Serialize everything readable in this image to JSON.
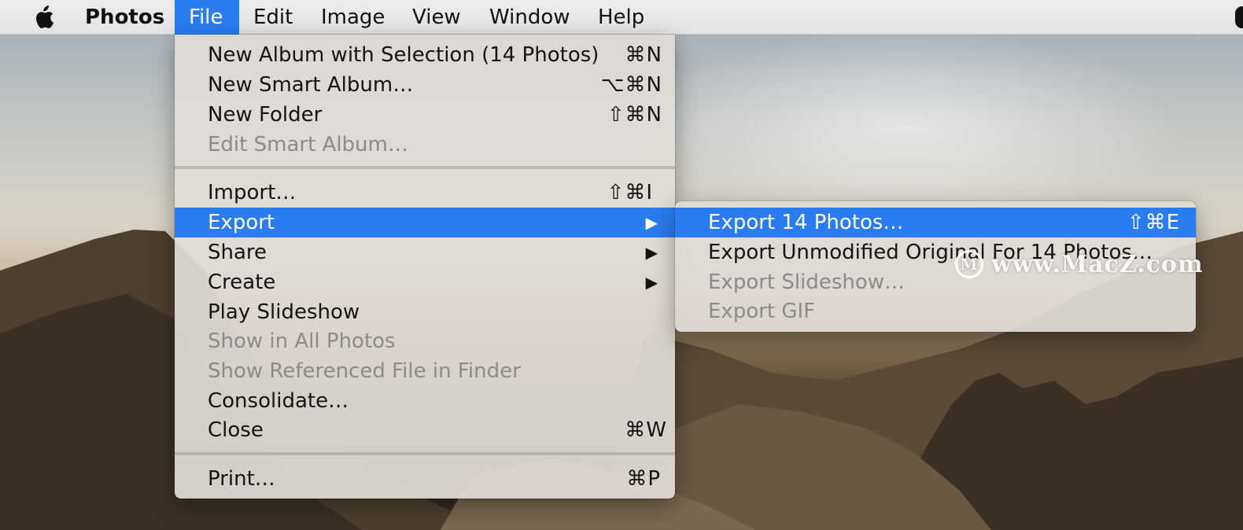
{
  "menubar": {
    "app_name": "Photos",
    "items": [
      "File",
      "Edit",
      "Image",
      "View",
      "Window",
      "Help"
    ],
    "active_item": "File",
    "accent_color": "#2a7cf0"
  },
  "file_menu": {
    "items": [
      {
        "label": "New Album with Selection (14 Photos)",
        "shortcut": "⌘N",
        "enabled": true
      },
      {
        "label": "New Smart Album…",
        "shortcut": "⌥⌘N",
        "enabled": true
      },
      {
        "label": "New Folder",
        "shortcut": "⇧⌘N",
        "enabled": true
      },
      {
        "label": "Edit Smart Album…",
        "shortcut": "",
        "enabled": false
      },
      {
        "label": "Import…",
        "shortcut": "⇧⌘I",
        "enabled": true
      },
      {
        "label": "Export",
        "submenu_arrow": "▶",
        "enabled": true,
        "highlighted": true
      },
      {
        "label": "Share",
        "submenu_arrow": "▶",
        "enabled": true
      },
      {
        "label": "Create",
        "submenu_arrow": "▶",
        "enabled": true
      },
      {
        "label": "Play Slideshow",
        "shortcut": "",
        "enabled": true
      },
      {
        "label": "Show in All Photos",
        "shortcut": "",
        "enabled": false
      },
      {
        "label": "Show Referenced File in Finder",
        "shortcut": "",
        "enabled": false
      },
      {
        "label": "Consolidate…",
        "shortcut": "",
        "enabled": true
      },
      {
        "label": "Close",
        "shortcut": "⌘W",
        "enabled": true
      },
      {
        "label": "Print…",
        "shortcut": "⌘P",
        "enabled": true
      }
    ]
  },
  "export_submenu": {
    "items": [
      {
        "label": "Export 14 Photos…",
        "shortcut": "⇧⌘E",
        "enabled": true,
        "highlighted": true
      },
      {
        "label": "Export Unmodified Original For 14 Photos…",
        "shortcut": "",
        "enabled": true
      },
      {
        "label": "Export Slideshow…",
        "shortcut": "",
        "enabled": false
      },
      {
        "label": "Export GIF",
        "shortcut": "",
        "enabled": false
      }
    ]
  },
  "watermark": {
    "text": "www.MacZ.com",
    "logo_letter": "M"
  }
}
